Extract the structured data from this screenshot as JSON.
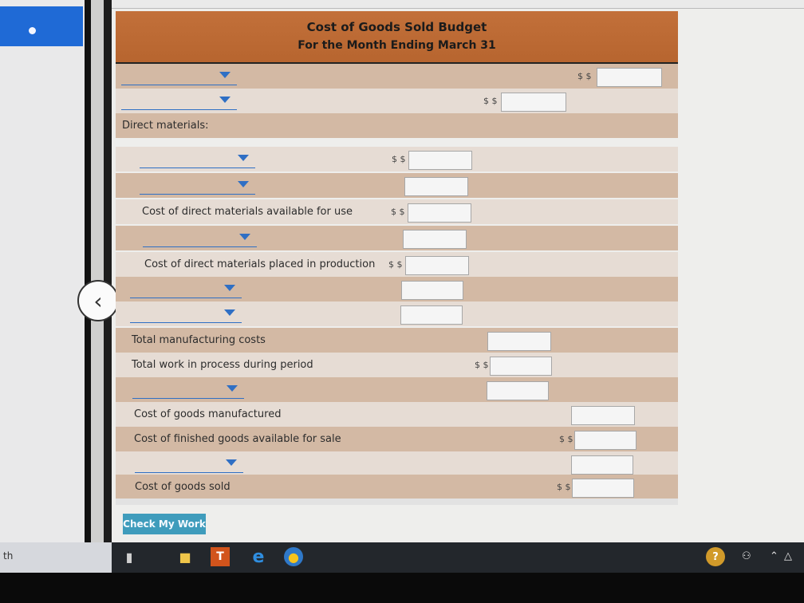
{
  "header": {
    "title": "Cost of Goods Sold Budget",
    "subtitle": "For the Month Ending March 31"
  },
  "rows": {
    "direct_materials": "Direct materials:",
    "dm_available": "Cost of direct materials available for use",
    "dm_placed": "Cost of direct materials placed in production",
    "total_mfg": "Total manufacturing costs",
    "total_wip": "Total work in process during period",
    "cogm": "Cost of goods manufactured",
    "finished_avail": "Cost of finished goods available for sale",
    "cogs": "Cost of goods sold"
  },
  "currency": "$ $",
  "check_button": "Check My Work",
  "taskbar": {
    "search_text": "th"
  },
  "colors": {
    "header": "#b96831",
    "accent": "#2f6fc4",
    "button": "#3f9cbc"
  }
}
